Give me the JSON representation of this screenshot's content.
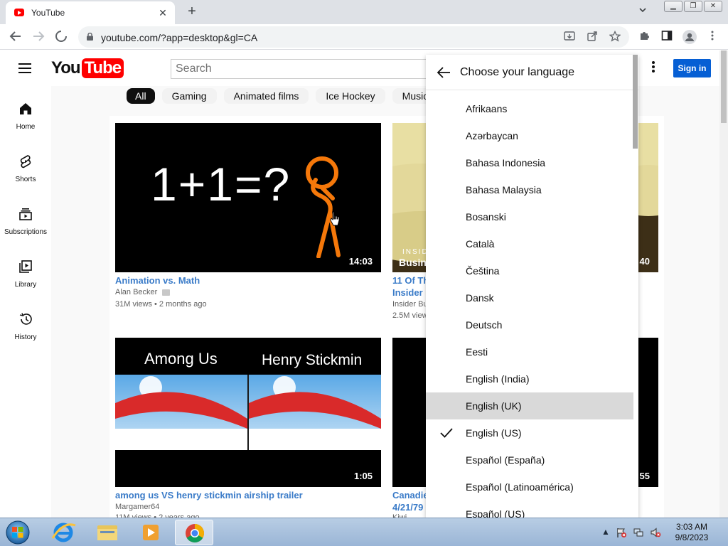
{
  "browser": {
    "tab_title": "YouTube",
    "tab_close": "✕",
    "new_tab": "+",
    "url": "youtube.com/?app=desktop&gl=CA"
  },
  "youtube": {
    "search_placeholder": "Search",
    "signin_label": "Sign in",
    "logo": {
      "you": "You",
      "tube": "Tube"
    },
    "sidebar": [
      {
        "label": "Home",
        "icon": "home-icon"
      },
      {
        "label": "Shorts",
        "icon": "shorts-icon"
      },
      {
        "label": "Subscriptions",
        "icon": "subscriptions-icon"
      },
      {
        "label": "Library",
        "icon": "library-icon"
      },
      {
        "label": "History",
        "icon": "history-icon"
      }
    ],
    "chips": [
      "All",
      "Gaming",
      "Animated films",
      "Ice Hockey",
      "Music"
    ],
    "videos": [
      {
        "thumb_text": "1+1=?",
        "duration": "14:03",
        "title": "Animation vs. Math",
        "channel": "Alan Becker",
        "meta": "31M views • 2 months ago"
      },
      {
        "thumb_text": "Busine",
        "thumb_small": "INSID",
        "duration": "40",
        "title": "11 Of Th",
        "title2": "Insider B",
        "channel": "Insider Bu",
        "meta": "2.5M view"
      },
      {
        "thumb_text_left": "Among Us",
        "thumb_text_right": "Henry Stickmin",
        "duration": "1:05",
        "title": "among us VS henry stickmin airship trailer",
        "channel": "Margamer64",
        "meta": "11M views • 2 years ago"
      },
      {
        "duration": "55",
        "title": "Canadie",
        "title2": "4/21/79",
        "channel": "Kiwi"
      }
    ]
  },
  "language_menu": {
    "heading": "Choose your language",
    "items": [
      {
        "label": "Afrikaans"
      },
      {
        "label": "Azərbaycan"
      },
      {
        "label": "Bahasa Indonesia"
      },
      {
        "label": "Bahasa Malaysia"
      },
      {
        "label": "Bosanski"
      },
      {
        "label": "Català"
      },
      {
        "label": "Čeština"
      },
      {
        "label": "Dansk"
      },
      {
        "label": "Deutsch"
      },
      {
        "label": "Eesti"
      },
      {
        "label": "English (India)"
      },
      {
        "label": "English (UK)",
        "hovered": true
      },
      {
        "label": "English (US)",
        "selected": true
      },
      {
        "label": "Español (España)"
      },
      {
        "label": "Español (Latinoamérica)"
      },
      {
        "label": "Español (US)"
      }
    ]
  },
  "taskbar": {
    "time": "3:03 AM",
    "date": "9/8/2023"
  },
  "colors": {
    "signin_blue": "#065fd4",
    "link_blue": "#3a7bc8",
    "yt_red": "#ff0000",
    "stickman_orange": "#f5780a"
  }
}
